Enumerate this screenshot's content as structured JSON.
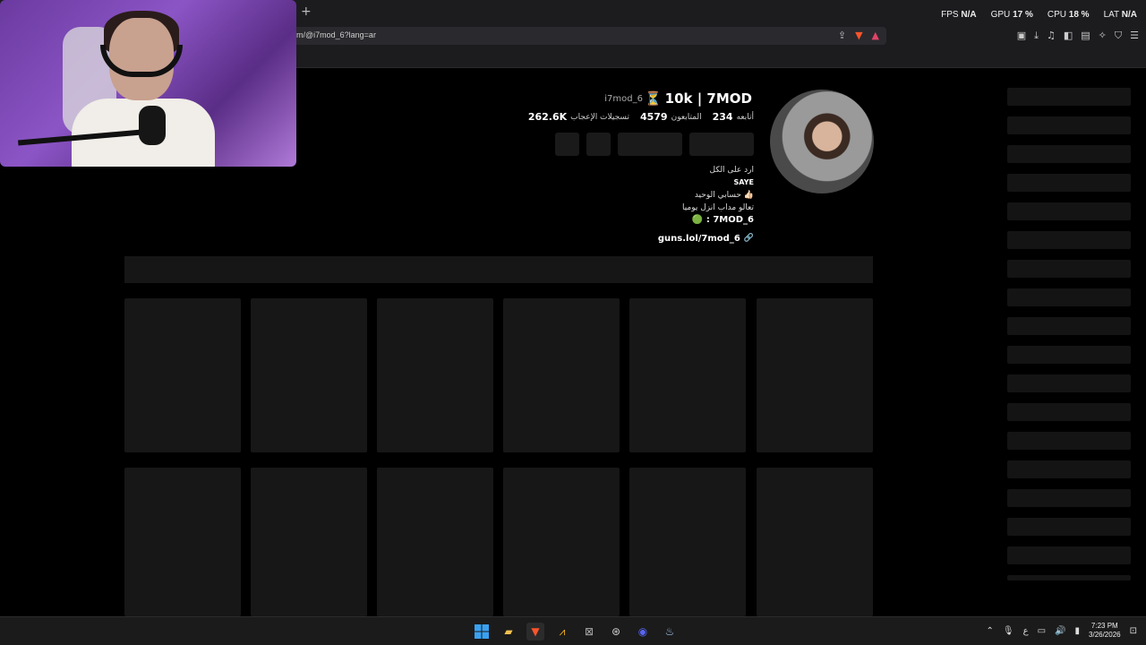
{
  "overlay": {
    "fps_label": "FPS",
    "fps_value": "N/A",
    "gpu_label": "GPU",
    "gpu_value": "17 %",
    "cpu_label": "CPU",
    "cpu_value": "18 %",
    "lat_label": "LAT",
    "lat_value": "N/A"
  },
  "browser": {
    "url": "m/@i7mod_6?lang=ar",
    "new_tab_glyph": "+"
  },
  "profile": {
    "display_name": "10k | 7MOD",
    "display_name_emoji": "⏳",
    "username": "i7mod_6",
    "stats": [
      {
        "value": "234",
        "label": "أتابعه"
      },
      {
        "value": "4579",
        "label": "المتابعون"
      },
      {
        "value": "262.6K",
        "label": "تسجيلات الإعجاب"
      }
    ],
    "bio_lines": [
      "ارد على الكل",
      "SAYE",
      "حسابي الوحيد 👍🏻",
      "تعالو مداب انزل يوميا",
      "🟢 : 7MOD_6"
    ],
    "link": "guns.lol/7mod_6",
    "link_icon": "🔗"
  },
  "taskbar": {
    "time": "7:23 PM",
    "date": "3/26/2026",
    "lang": "ع"
  },
  "colors": {
    "background": "#000000",
    "chrome": "#1c1c1f",
    "placeholder": "#171717",
    "brave": "#fb542b"
  }
}
